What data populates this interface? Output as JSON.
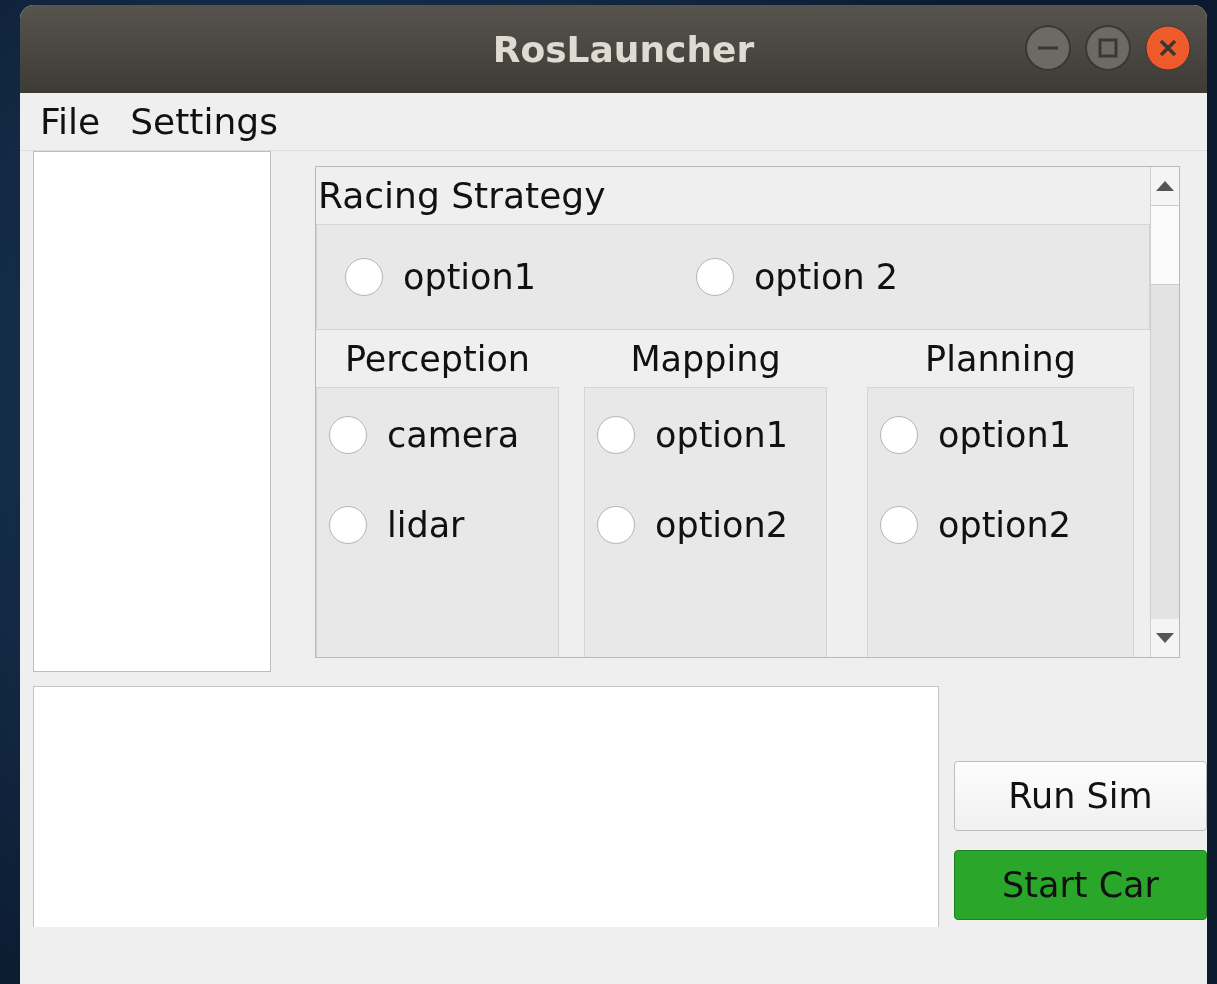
{
  "window": {
    "title": "RosLauncher"
  },
  "menu": [
    {
      "label": "File"
    },
    {
      "label": "Settings"
    }
  ],
  "racing_strategy": {
    "title": "Racing Strategy",
    "options": [
      {
        "label": "option1",
        "selected": false
      },
      {
        "label": "option 2",
        "selected": false
      }
    ]
  },
  "groups": [
    {
      "title": "Perception",
      "options": [
        {
          "label": "camera",
          "selected": false
        },
        {
          "label": "lidar",
          "selected": false
        }
      ]
    },
    {
      "title": "Mapping",
      "options": [
        {
          "label": "option1",
          "selected": false
        },
        {
          "label": "option2",
          "selected": false
        }
      ]
    },
    {
      "title": "Planning",
      "options": [
        {
          "label": "option1",
          "selected": false
        },
        {
          "label": "option2",
          "selected": false
        }
      ]
    }
  ],
  "buttons": [
    {
      "label": "Run Sim",
      "kind": "normal"
    },
    {
      "label": "Start Car",
      "kind": "primary"
    }
  ]
}
